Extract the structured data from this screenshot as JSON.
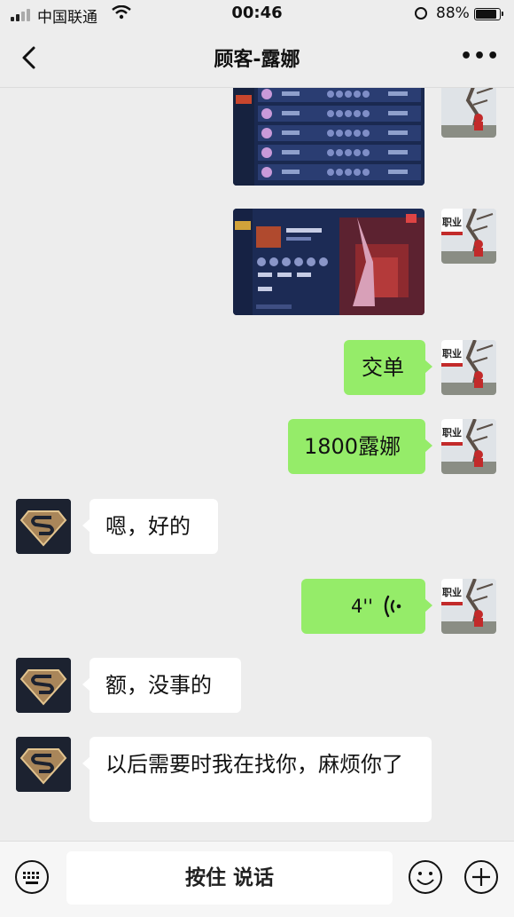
{
  "status_bar": {
    "carrier": "中国联通",
    "time": "00:46",
    "battery": "88%",
    "battery_level": 0.88
  },
  "header": {
    "title": "顾客-露娜"
  },
  "messages": [
    {
      "sender": "me",
      "type": "image",
      "description": "game-match-history"
    },
    {
      "sender": "me",
      "type": "image",
      "description": "game-profile"
    },
    {
      "sender": "me",
      "type": "text",
      "text": "交单"
    },
    {
      "sender": "me",
      "type": "text",
      "text": "1800露娜"
    },
    {
      "sender": "customer",
      "type": "text",
      "text": "嗯，好的"
    },
    {
      "sender": "me",
      "type": "voice",
      "duration": "4''"
    },
    {
      "sender": "customer",
      "type": "text",
      "text": "额，没事的"
    },
    {
      "sender": "customer",
      "type": "text",
      "text": "以后需要时我在找你，麻烦你了"
    }
  ],
  "my_avatar_badge": "职业",
  "input_bar": {
    "hold_to_talk": "按住 说话"
  },
  "colors": {
    "sent_bubble": "#95ec69",
    "received_bubble": "#ffffff",
    "background": "#ededed"
  }
}
